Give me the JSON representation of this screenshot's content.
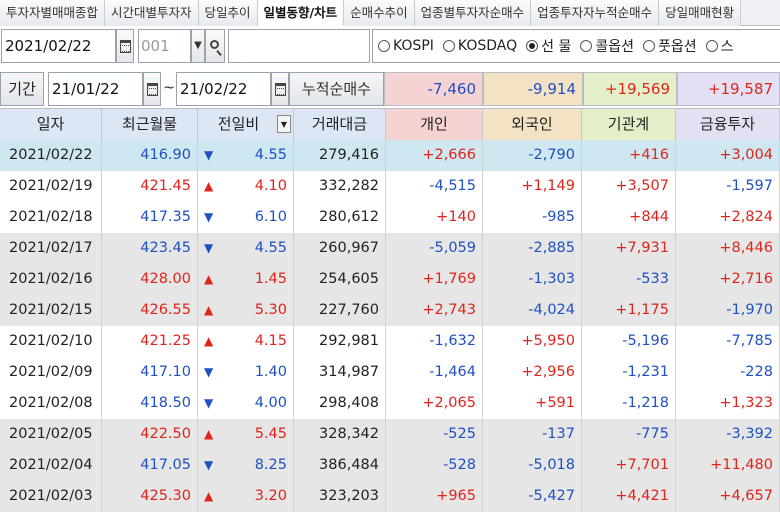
{
  "tabs": [
    "투자자별매매종합",
    "시간대별투자자",
    "당일추이",
    "일별동향/차트",
    "순매수추이",
    "업종별투자자순매수",
    "업종투자자누적순매수",
    "당일매매현황"
  ],
  "active_tab_index": 3,
  "controls": {
    "date": "2021/02/22",
    "code_value": "001",
    "dropdown_glyph": "▼",
    "name_value": "",
    "markets": [
      {
        "label": "KOSPI",
        "selected": false
      },
      {
        "label": "KOSDAQ",
        "selected": false
      },
      {
        "label": "선 물",
        "selected": true
      },
      {
        "label": "콜옵션",
        "selected": false
      },
      {
        "label": "풋옵션",
        "selected": false
      },
      {
        "label": "스",
        "selected": false
      }
    ]
  },
  "period": {
    "label": "기간",
    "start": "21/01/22",
    "tilde": "~",
    "end": "21/02/22",
    "cumulative_label": "누적순매수",
    "cumulative": [
      {
        "value": "-7,460",
        "bg": "#f6d3d3",
        "color": "#1f50c4"
      },
      {
        "value": "-9,914",
        "bg": "#f3e3c4",
        "color": "#1f50c4"
      },
      {
        "value": "+19,569",
        "bg": "#e2efc8",
        "color": "#e0241c"
      },
      {
        "value": "+19,587",
        "bg": "#e4e0f4",
        "color": "#e0241c"
      }
    ]
  },
  "table": {
    "headers": [
      {
        "label": "일자",
        "bg": "#dde6f5"
      },
      {
        "label": "최근월물",
        "bg": "#dde6f5"
      },
      {
        "label": "전일비",
        "bg": "#dde6f5",
        "sort_glyph": "▼"
      },
      {
        "label": "거래대금",
        "bg": "#dde6f5"
      },
      {
        "label": "개인",
        "bg": "#f6d3d3"
      },
      {
        "label": "외국인",
        "bg": "#f3e3c4"
      },
      {
        "label": "기관계",
        "bg": "#e2efc8"
      },
      {
        "label": "금융투자",
        "bg": "#e4e0f4"
      }
    ],
    "rows": [
      {
        "date": "2021/02/22",
        "price": "416.90",
        "dir": "down",
        "change": "4.55",
        "volume": "279,416",
        "individual": "+2,666",
        "foreign": "-2,790",
        "institution": "+416",
        "financial": "+3,004"
      },
      {
        "date": "2021/02/19",
        "price": "421.45",
        "dir": "up",
        "change": "4.10",
        "volume": "332,282",
        "individual": "-4,515",
        "foreign": "+1,149",
        "institution": "+3,507",
        "financial": "-1,597"
      },
      {
        "date": "2021/02/18",
        "price": "417.35",
        "dir": "down",
        "change": "6.10",
        "volume": "280,612",
        "individual": "+140",
        "foreign": "-985",
        "institution": "+844",
        "financial": "+2,824"
      },
      {
        "date": "2021/02/17",
        "price": "423.45",
        "dir": "down",
        "change": "4.55",
        "volume": "260,967",
        "individual": "-5,059",
        "foreign": "-2,885",
        "institution": "+7,931",
        "financial": "+8,446"
      },
      {
        "date": "2021/02/16",
        "price": "428.00",
        "dir": "up",
        "change": "1.45",
        "volume": "254,605",
        "individual": "+1,769",
        "foreign": "-1,303",
        "institution": "-533",
        "financial": "+2,716"
      },
      {
        "date": "2021/02/15",
        "price": "426.55",
        "dir": "up",
        "change": "5.30",
        "volume": "227,760",
        "individual": "+2,743",
        "foreign": "-4,024",
        "institution": "+1,175",
        "financial": "-1,970"
      },
      {
        "date": "2021/02/10",
        "price": "421.25",
        "dir": "up",
        "change": "4.15",
        "volume": "292,981",
        "individual": "-1,632",
        "foreign": "+5,950",
        "institution": "-5,196",
        "financial": "-7,785"
      },
      {
        "date": "2021/02/09",
        "price": "417.10",
        "dir": "down",
        "change": "1.40",
        "volume": "314,987",
        "individual": "-1,464",
        "foreign": "+2,956",
        "institution": "-1,231",
        "financial": "-228"
      },
      {
        "date": "2021/02/08",
        "price": "418.50",
        "dir": "down",
        "change": "4.00",
        "volume": "298,408",
        "individual": "+2,065",
        "foreign": "+591",
        "institution": "-1,218",
        "financial": "+1,323"
      },
      {
        "date": "2021/02/05",
        "price": "422.50",
        "dir": "up",
        "change": "5.45",
        "volume": "328,342",
        "individual": "-525",
        "foreign": "-137",
        "institution": "-775",
        "financial": "-3,392"
      },
      {
        "date": "2021/02/04",
        "price": "417.05",
        "dir": "down",
        "change": "8.25",
        "volume": "386,484",
        "individual": "-528",
        "foreign": "-5,018",
        "institution": "+7,701",
        "financial": "+11,480"
      },
      {
        "date": "2021/02/03",
        "price": "425.30",
        "dir": "up",
        "change": "3.20",
        "volume": "323,203",
        "individual": "+965",
        "foreign": "-5,427",
        "institution": "+4,421",
        "financial": "+4,657"
      }
    ]
  },
  "colors": {
    "up": "#e0241c",
    "down": "#1f50c4",
    "selected_row": "#cfe7f1",
    "grey_row": "#e6e6e6"
  },
  "icons": {
    "up": "▲",
    "down": "▼"
  }
}
